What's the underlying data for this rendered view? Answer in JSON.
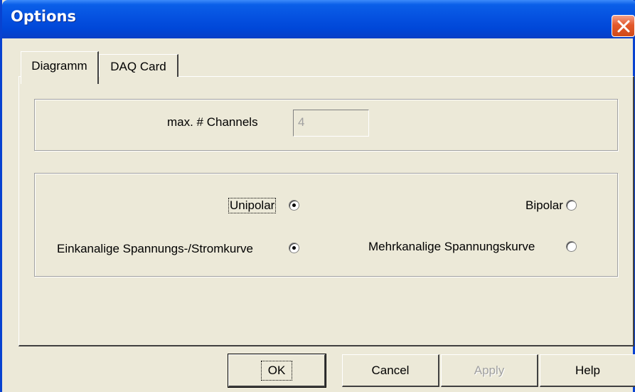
{
  "window": {
    "title": "Options",
    "close_icon": "close-icon"
  },
  "tabs": [
    {
      "label": "Diagramm",
      "active": true
    },
    {
      "label": "DAQ Card",
      "active": false
    }
  ],
  "channels": {
    "label": "max. # Channels",
    "value": "4",
    "disabled": true
  },
  "options": {
    "unipolar": {
      "label": "Unipolar",
      "checked": true
    },
    "bipolar": {
      "label": "Bipolar",
      "checked": false
    },
    "einkanalig": {
      "label": "Einkanalige Spannungs-/Stromkurve",
      "checked": true
    },
    "mehrkanalig": {
      "label": "Mehrkanalige Spannungskurve",
      "checked": false
    }
  },
  "buttons": {
    "ok": "OK",
    "cancel": "Cancel",
    "apply": "Apply",
    "help": "Help"
  },
  "colors": {
    "titlebar": "#0551e0",
    "dialog_bg": "#ece9d8",
    "close_button": "#e3592c"
  }
}
